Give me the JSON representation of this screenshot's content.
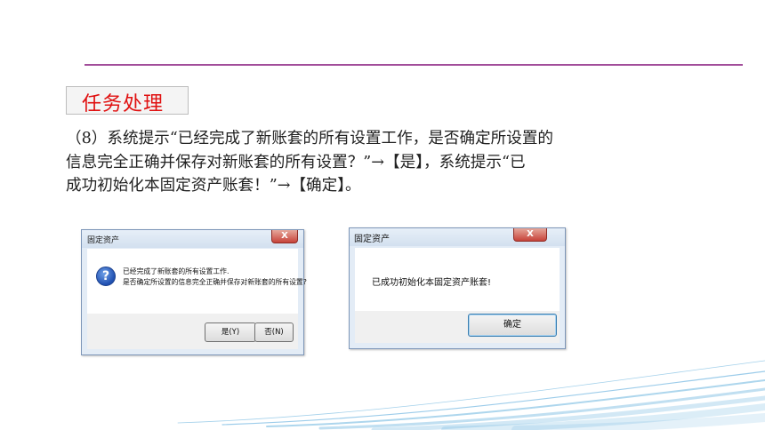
{
  "section": {
    "label": "任务处理"
  },
  "instructions": {
    "lines": [
      "（8）系统提示“已经完成了新账套的所有设置工作，是否确定所设置的",
      "信息完全正确并保存对新账套的所有设置？”→【是】，系统提示“已",
      "成功初始化本固定资产账套！”→【确定】。"
    ]
  },
  "dialog_confirm": {
    "title": "固定资产",
    "close_label": "X",
    "icon": "question-icon",
    "message_line1": "已经完成了新账套的所有设置工作.",
    "message_line2": "是否确定所设置的信息完全正确并保存对新账套的所有设置?",
    "yes_label": "是(Y)",
    "no_label": "否(N)"
  },
  "dialog_done": {
    "title": "固定资产",
    "close_label": "X",
    "message": "已成功初始化本固定资产账套!",
    "ok_label": "确定"
  },
  "colors": {
    "rule": "#a24d9a",
    "section_text": "#e01010",
    "swoosh": "#4aa3d8"
  }
}
